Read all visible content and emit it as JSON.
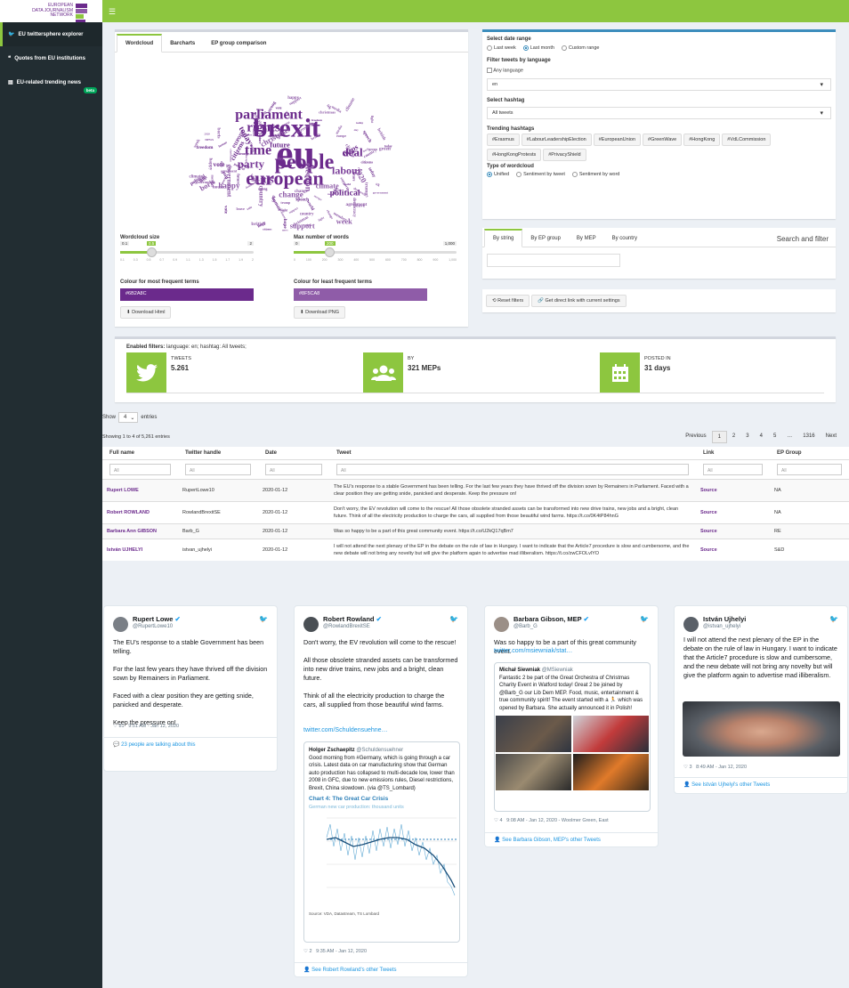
{
  "brand": {
    "line1": "EUROPEAN",
    "line2": "DATA JOURNALISM",
    "line3": "NETWORK",
    "colors": [
      "#6b2a8c",
      "#8f5ca8",
      "#8dc63f"
    ]
  },
  "sidebar": {
    "items": [
      {
        "label": "EU twittersphere explorer",
        "icon": "twitter-icon"
      },
      {
        "label": "Quotes from EU institutions",
        "icon": "quote-icon"
      },
      {
        "label": "EU-related trending news",
        "icon": "newspaper-icon",
        "badge": "beta"
      }
    ]
  },
  "wc_tabs": [
    "Wordcloud",
    "Barcharts",
    "EP group comparison"
  ],
  "wordcloud": {
    "words": [
      "eu",
      "brexit",
      "european",
      "people",
      "parliament",
      "time",
      "party",
      "rights",
      "deal",
      "labour",
      "it's",
      "vote",
      "government",
      "europe",
      "future",
      "christmas",
      "election",
      "political",
      "happy",
      "week",
      "citizens",
      "country",
      "support",
      "today",
      "climate",
      "2020",
      "meps",
      "boris",
      "change",
      "hope",
      "british",
      "day",
      "world",
      "news",
      "uk",
      "join",
      "leave",
      "agreement",
      "strong",
      "voted",
      "fight",
      "freedom",
      "democracy",
      "trump",
      "speech",
      "house",
      "green",
      "human",
      "media",
      "member"
    ]
  },
  "controls": {
    "size_label": "Wordcloud size",
    "size_min": "0.1",
    "size_val": "0.5",
    "size_max": "2",
    "size_ticks": [
      "0.1",
      "0.3",
      "0.5",
      "0.7",
      "0.9",
      "1.1",
      "1.3",
      "1.5",
      "1.7",
      "1.9",
      "2"
    ],
    "max_label": "Max number of words",
    "max_min": "0",
    "max_val": "200",
    "max_max": "1,000",
    "max_ticks": [
      "0",
      "100",
      "200",
      "300",
      "400",
      "500",
      "600",
      "700",
      "800",
      "900",
      "1,000"
    ],
    "most_label": "Colour for most frequent terms",
    "most_color": "#6B2A8C",
    "least_label": "Colour for least frequent terms",
    "least_color": "#8F5CA8",
    "dl_html": "Download Html",
    "dl_png": "Download PNG"
  },
  "filters": {
    "date_label": "Select date range",
    "date_opts": [
      "Last week",
      "Last month",
      "Custom range"
    ],
    "lang_label": "Filter tweets by language",
    "any_lang": "Any language",
    "lang_value": "en",
    "hashtag_label": "Select hashtag",
    "hashtag_value": "All tweets",
    "trending_label": "Trending hashtags",
    "trending": [
      "#Erasmus",
      "#LabourLeadershipElection",
      "#EuropeanUnion",
      "#GreenWave",
      "#HongKong",
      "#VdLCommission",
      "#HongKongProtests",
      "#PrivacyShield"
    ],
    "type_label": "Type of wordcloud",
    "type_opts": [
      "Unified",
      "Sentiment by tweet",
      "Sentiment by word"
    ]
  },
  "search": {
    "tabs": [
      "By string",
      "By EP group",
      "By MEP",
      "By country"
    ],
    "title": "Search and filter"
  },
  "actions": {
    "reset": "Reset filters",
    "link": "Get direct link with current settings"
  },
  "stats": {
    "enabled_prefix": "Enabled filters:",
    "enabled_text": " language: en; hashtag: All tweets;",
    "tweets_label": "TWEETS",
    "tweets_val": "5.261",
    "by_label": "BY",
    "by_val": "321 MEPs",
    "posted_label": "POSTED IN",
    "posted_val": "31 days"
  },
  "table": {
    "show": "Show",
    "show_val": "4",
    "entries": "entries",
    "info": "Showing 1 to 4 of 5,261 entries",
    "pager": [
      "Previous",
      "1",
      "2",
      "3",
      "4",
      "5",
      "…",
      "1316",
      "Next"
    ],
    "headers": [
      "Full name",
      "Twitter handle",
      "Date",
      "Tweet",
      "Link",
      "EP Group"
    ],
    "filter_ph": "All",
    "rows": [
      {
        "name": "Rupert LOWE",
        "handle": "RupertLowe10",
        "date": "2020-01-12",
        "tweet": "The EU's response to a stable Government has been telling. For the last few years they have thrived off the division sown by Remainers in Parliament. Faced with a clear position they are getting snide, panicked and desperate. Keep the pressure on!",
        "link": "Source",
        "group": "NA"
      },
      {
        "name": "Robert ROWLAND",
        "handle": "RowlandBrexitSE",
        "date": "2020-01-12",
        "tweet": "Don't worry, the EV revolution will come to the rescue! All those obsolete stranded assets can be transformed into new drive trains, new jobs and a bright, clean future. Think of all the electricity production to charge the cars, all supplied from those beautiful wind farms. https://t.co/0K4tP84hnG",
        "link": "Source",
        "group": "NA"
      },
      {
        "name": "Barbara Ann GIBSON",
        "handle": "Barb_G",
        "date": "2020-01-12",
        "tweet": "Was so happy to be a part of this great community event. https://t.co/U2kQ17qBm7",
        "link": "Source",
        "group": "RE"
      },
      {
        "name": "István UJHELYI",
        "handle": "istvan_ujhelyi",
        "date": "2020-01-12",
        "tweet": "I will not attend the next plenary of the EP in the debate on the rule of law in Hungary. I want to indicate that the Article7 procedure is slow and cumbersome, and the new debate will not bring any novelty but will give the platform again to advertise mad illiberalism. https://t.co/zwCFOLvlYO",
        "link": "Source",
        "group": "S&D"
      }
    ]
  },
  "tweets": [
    {
      "name": "Rupert Lowe",
      "handle": "@RupertLowe10",
      "body": "The EU's response to a stable Government has been telling.\n\nFor the last few years they have thrived off the division sown by Remainers in Parliament.\n\nFaced with a clear position they are getting snide, panicked and desperate.\n\nKeep the pressure on!",
      "likes": "81",
      "time": "9:51 AM - Jan 12, 2020",
      "more": "23 people are talking about this"
    },
    {
      "name": "Robert Rowland",
      "handle": "@RowlandBrexitSE",
      "body": "Don't worry, the EV revolution will come to the rescue!\n\nAll those obsolete stranded assets can be transformed into new drive trains, new jobs and a bright, clean future.\n\nThink of all the electricity production to charge the cars, all supplied from those beautiful wind farms.",
      "link": "twitter.com/Schuldensuehne…",
      "q_name": "Holger Zschaepitz",
      "q_handle": "@Schuldensuehner",
      "q_body": "Good morning from #Germany, which is going through a car crisis. Latest data on car manufacturing show that German auto production has collapsed to multi-decade low, lower than 2008 in GFC, due to new emissions rules, Diesel restrictions, Brexit, China slowdown. (via @TS_Lombard)",
      "chart_title": "Chart 4: The Great Car Crisis",
      "chart_sub": "German new car production: thousand units",
      "chart_legend": [
        "Actual",
        "6M MA",
        "GFC minimum"
      ],
      "chart_source": "Source: VDA, Datastream, TS Lombard",
      "likes": "2",
      "time": "9:35 AM - Jan 12, 2020",
      "more": "See Robert Rowland's other Tweets"
    },
    {
      "name": "Barbara Gibson, MEP",
      "handle": "@Barb_G",
      "body": "Was so happy to be a part of this great community event.",
      "link": "twitter.com/msiewniak/stat…",
      "q_name": "Michał Siewniak",
      "q_handle": "@MSiewniak",
      "q_body": "Fantastic 2 be part of the Great Orchestra of Christmas Charity Event in Watford today! Great 2 be joined by @Barb_G our Lib Dem MEP. Food, music, entertainment & true community spirit! The event started with a 🏃 which was opened by Barbara. She actually announced it in Polish!",
      "likes": "4",
      "time": "9:08 AM - Jan 12, 2020 - Woolmer Green, East",
      "more": "See Barbara Gibson, MEP's other Tweets"
    },
    {
      "name": "István Ujhelyi",
      "handle": "@istvan_ujhelyi",
      "body": "I will not attend the next plenary of the EP in the debate on the rule of law in Hungary. I want to indicate that the Article7 procedure is slow and cumbersome, and the new debate will not bring any novelty but will give the platform again to advertise mad illiberalism.",
      "likes": "3",
      "time": "8:49 AM - Jan 12, 2020",
      "more": "See István Ujhelyi's other Tweets"
    }
  ]
}
